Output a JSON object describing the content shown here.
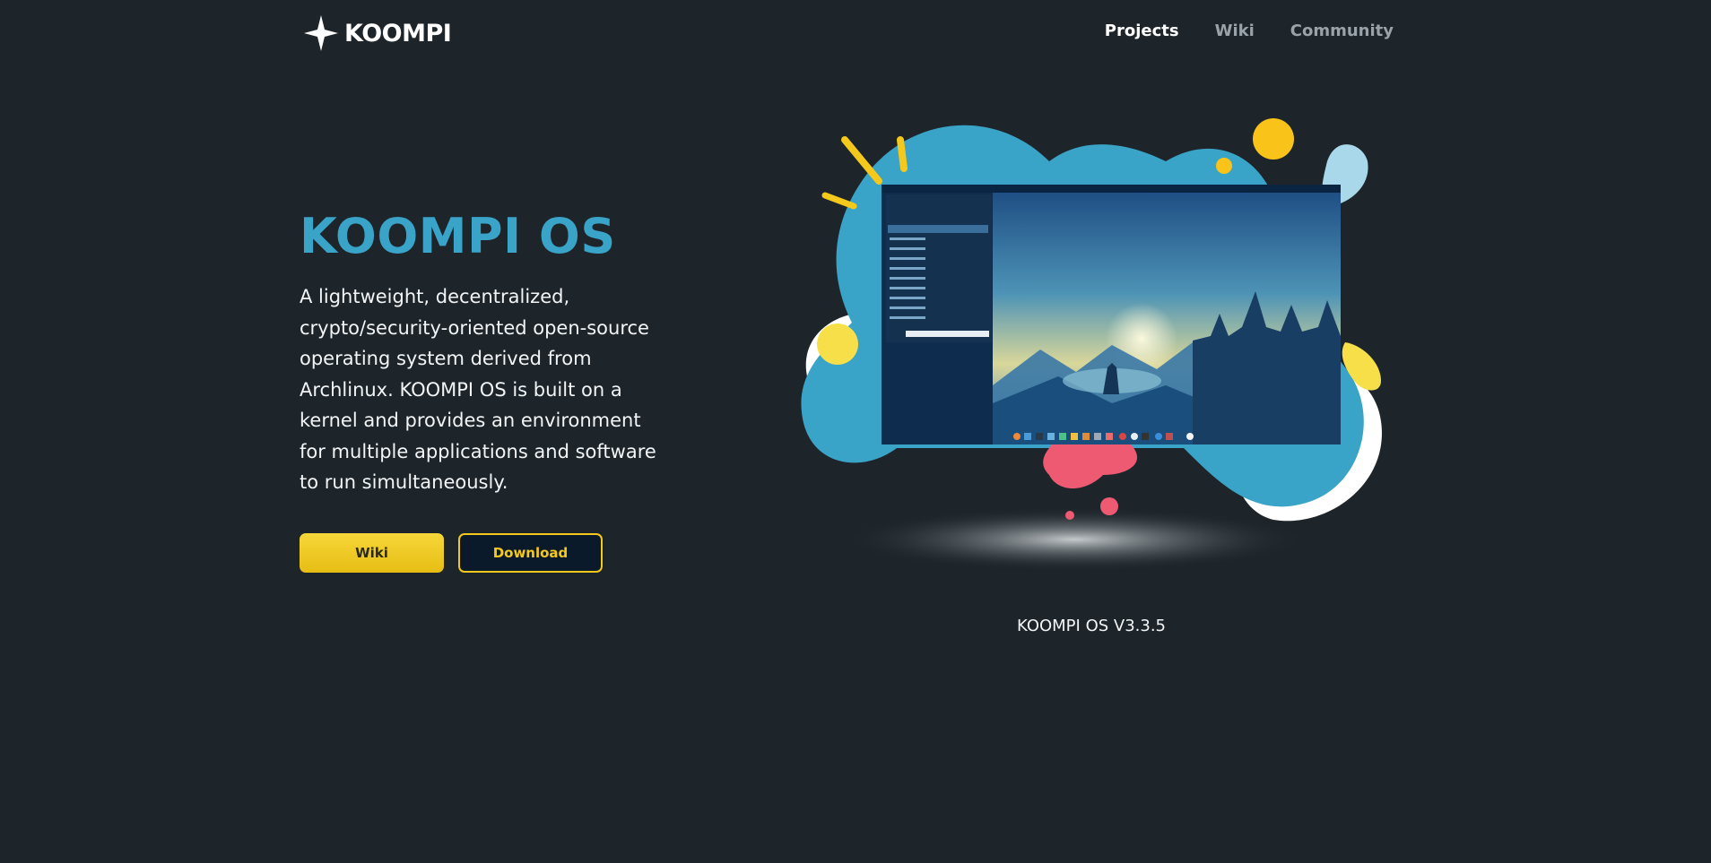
{
  "brand": {
    "name": "KOOMPI"
  },
  "nav": {
    "items": [
      {
        "label": "Projects",
        "active": true
      },
      {
        "label": "Wiki",
        "active": false
      },
      {
        "label": "Community",
        "active": false
      }
    ]
  },
  "hero": {
    "title": "KOOMPI OS",
    "description": "A lightweight, decentralized, crypto/security-oriented open-source operating system derived from Archlinux. KOOMPI OS is built on a kernel and provides an environment for multiple applications and software to run simultaneously.",
    "buttons": {
      "wiki": "Wiki",
      "download": "Download"
    }
  },
  "showcase": {
    "version": "KOOMPI OS V3.3.5"
  },
  "colors": {
    "background": "#1d252b",
    "accent": "#3aa3c8",
    "button_yellow": "#f4c91c"
  }
}
